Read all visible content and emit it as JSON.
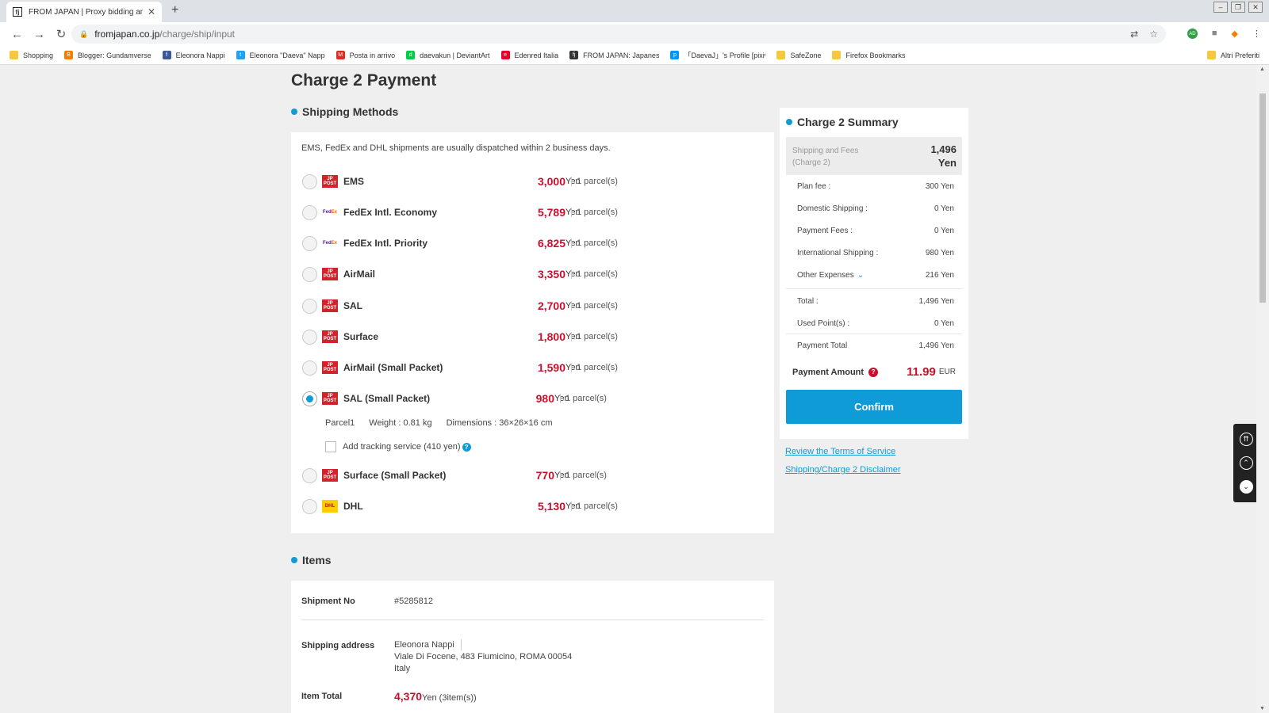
{
  "browser": {
    "tab_title": "FROM JAPAN | Proxy bidding and o",
    "tab_favicon": "fj",
    "url_host": "fromjapan.co.jp",
    "url_path": "/charge/ship/input",
    "ext_badge": "AD",
    "bookmarks": [
      {
        "label": "Shopping",
        "icon": "folder-icon",
        "color": "#f5c842",
        "glyph": ""
      },
      {
        "label": "Blogger: Gundamverse",
        "icon": "blogger-icon",
        "color": "#f57d00",
        "glyph": "B"
      },
      {
        "label": "Eleonora Nappi",
        "icon": "facebook-icon",
        "color": "#3b5998",
        "glyph": "f"
      },
      {
        "label": "Eleonora \"Daeva\" Napp",
        "icon": "twitter-icon",
        "color": "#1da1f2",
        "glyph": "t"
      },
      {
        "label": "Posta in arrivo",
        "icon": "gmail-icon",
        "color": "#d93025",
        "glyph": "M"
      },
      {
        "label": "daevakun | DeviantArt",
        "icon": "deviantart-icon",
        "color": "#05cc47",
        "glyph": "d"
      },
      {
        "label": "Edenred Italia",
        "icon": "edenred-icon",
        "color": "#e4002b",
        "glyph": "e"
      },
      {
        "label": "FROM JAPAN: Japanes",
        "icon": "fromjapan-icon",
        "color": "#333333",
        "glyph": "fj"
      },
      {
        "label": "「DaevaJ」's Profile [pixiv]",
        "icon": "pixiv-icon",
        "color": "#0096fa",
        "glyph": "p"
      },
      {
        "label": "SafeZone",
        "icon": "folder-icon",
        "color": "#f5c842",
        "glyph": ""
      },
      {
        "label": "Firefox Bookmarks",
        "icon": "folder-icon",
        "color": "#f5c842",
        "glyph": ""
      }
    ],
    "other_bookmarks": "Altri Preferiti"
  },
  "page": {
    "title": "Charge 2 Payment",
    "shipping_section_title": "Shipping Methods",
    "notice": "EMS, FedEx and DHL shipments are usually dispatched within 2 business days.",
    "methods": [
      {
        "name": "EMS",
        "price": "3,000",
        "unit": "Yen",
        "parcels": "1 parcel(s)",
        "logo": "jppost",
        "selected": false
      },
      {
        "name": "FedEx Intl. Economy",
        "price": "5,789",
        "unit": "Yen",
        "parcels": "1 parcel(s)",
        "logo": "fedex",
        "selected": false
      },
      {
        "name": "FedEx Intl. Priority",
        "price": "6,825",
        "unit": "Yen",
        "parcels": "1 parcel(s)",
        "logo": "fedex",
        "selected": false
      },
      {
        "name": "AirMail",
        "price": "3,350",
        "unit": "Yen",
        "parcels": "1 parcel(s)",
        "logo": "jppost",
        "selected": false
      },
      {
        "name": "SAL",
        "price": "2,700",
        "unit": "Yen",
        "parcels": "1 parcel(s)",
        "logo": "jppost",
        "selected": false
      },
      {
        "name": "Surface",
        "price": "1,800",
        "unit": "Yen",
        "parcels": "1 parcel(s)",
        "logo": "jppost",
        "selected": false
      },
      {
        "name": "AirMail (Small Packet)",
        "price": "1,590",
        "unit": "Yen",
        "parcels": "1 parcel(s)",
        "logo": "jppost",
        "selected": false
      },
      {
        "name": "SAL (Small Packet)",
        "price": "980",
        "unit": "Yen",
        "parcels": "1 parcel(s)",
        "logo": "jppost",
        "selected": true
      },
      {
        "name": "Surface (Small Packet)",
        "price": "770",
        "unit": "Yen",
        "parcels": "1 parcel(s)",
        "logo": "jppost",
        "selected": false
      },
      {
        "name": "DHL",
        "price": "5,130",
        "unit": "Yen",
        "parcels": "1 parcel(s)",
        "logo": "dhl",
        "selected": false
      }
    ],
    "parcel_detail": {
      "name": "Parcel1",
      "weight": "Weight : 0.81 kg",
      "dimensions": "Dimensions : 36×26×16 cm"
    },
    "tracking_label": "Add tracking service (410 yen)",
    "logo_texts": {
      "jp_top": "JP",
      "jp_bottom": "POST",
      "fedex_a": "Fed",
      "fedex_b": "Ex",
      "dhl": "DHL"
    },
    "items_section_title": "Items",
    "items": {
      "shipment_no_label": "Shipment No",
      "shipment_no": "#5285812",
      "address_label": "Shipping address",
      "address_name": "Eleonora Nappi",
      "address_line": "Viale Di Focene, 483 Fiumicino, ROMA 00054",
      "address_country": "Italy",
      "item_total_label": "Item Total",
      "item_total_value": "4,370",
      "item_total_unit": "Yen",
      "item_total_count": "(3item(s))"
    }
  },
  "summary": {
    "title": "Charge 2 Summary",
    "head_label": "Shipping and Fees (Charge 2)",
    "head_value": "1,496",
    "head_unit": "Yen",
    "rows": [
      {
        "label": "Plan fee :",
        "value": "300 Yen"
      },
      {
        "label": "Domestic Shipping :",
        "value": "0 Yen"
      },
      {
        "label": "Payment Fees :",
        "value": "0 Yen"
      },
      {
        "label": "International Shipping :",
        "value": "980 Yen"
      },
      {
        "label": "Other Expenses",
        "value": "216 Yen"
      }
    ],
    "total_label": "Total :",
    "total_value": "1,496 Yen",
    "used_points_label": "Used Point(s) :",
    "used_points_value": "0 Yen",
    "payment_total_label": "Payment Total",
    "payment_total_value": "1,496 Yen",
    "payment_amount_label": "Payment Amount",
    "payment_amount_value": "11.99",
    "payment_amount_currency": "EUR",
    "confirm_label": "Confirm"
  },
  "links": {
    "terms": "Review the Terms of Service",
    "disclaimer": "Shipping/Charge 2 Disclaimer"
  },
  "colors": {
    "accent": "#0f9ad8",
    "price_red": "#c8102e"
  }
}
